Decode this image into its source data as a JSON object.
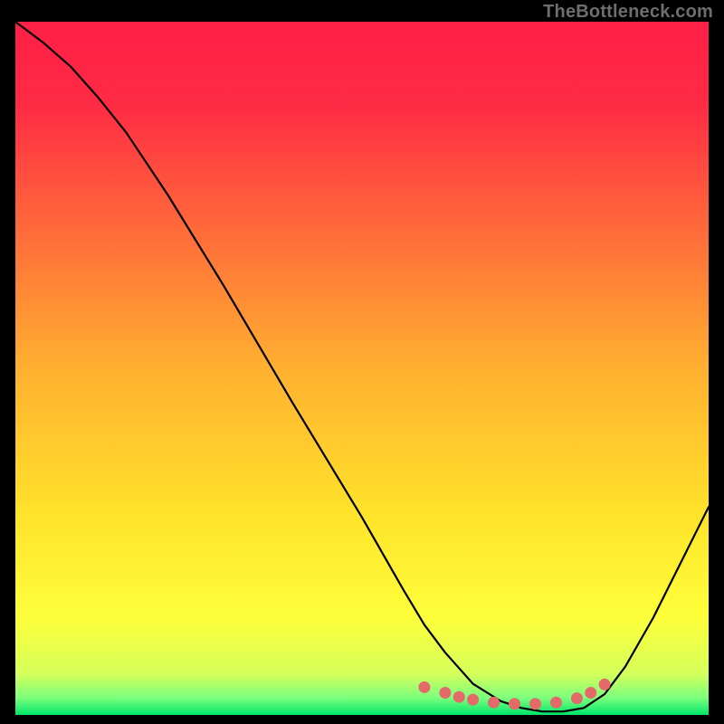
{
  "attribution": "TheBottleneck.com",
  "chart_data": {
    "type": "line",
    "title": "",
    "xlabel": "",
    "ylabel": "",
    "xlim": [
      0,
      100
    ],
    "ylim": [
      0,
      100
    ],
    "background_gradient": {
      "stops": [
        {
          "offset": 0.0,
          "color": "#ff1f47"
        },
        {
          "offset": 0.12,
          "color": "#ff2b44"
        },
        {
          "offset": 0.3,
          "color": "#ff6a3a"
        },
        {
          "offset": 0.5,
          "color": "#ffb030"
        },
        {
          "offset": 0.72,
          "color": "#ffe52a"
        },
        {
          "offset": 0.86,
          "color": "#fdff3a"
        },
        {
          "offset": 0.94,
          "color": "#d6ff5a"
        },
        {
          "offset": 0.975,
          "color": "#7dff7d"
        },
        {
          "offset": 1.0,
          "color": "#00e66b"
        }
      ]
    },
    "curve": {
      "x": [
        0,
        4,
        8,
        12,
        16,
        22,
        30,
        40,
        50,
        56,
        59,
        62,
        66,
        70,
        73,
        76,
        79,
        82,
        85,
        88,
        92,
        96,
        100
      ],
      "y": [
        100,
        97,
        93.5,
        89,
        84,
        75,
        62,
        45,
        28.5,
        18,
        13,
        9,
        4.5,
        2,
        1,
        0.5,
        0.5,
        1,
        3,
        7,
        14,
        22,
        30
      ]
    },
    "valley_marker": {
      "color": "#e46a6a",
      "x": [
        59,
        62,
        64,
        66,
        69,
        72,
        75,
        78,
        81,
        83,
        85
      ],
      "y": [
        4.0,
        3.2,
        2.6,
        2.2,
        1.8,
        1.6,
        1.6,
        1.8,
        2.4,
        3.2,
        4.4
      ]
    }
  }
}
